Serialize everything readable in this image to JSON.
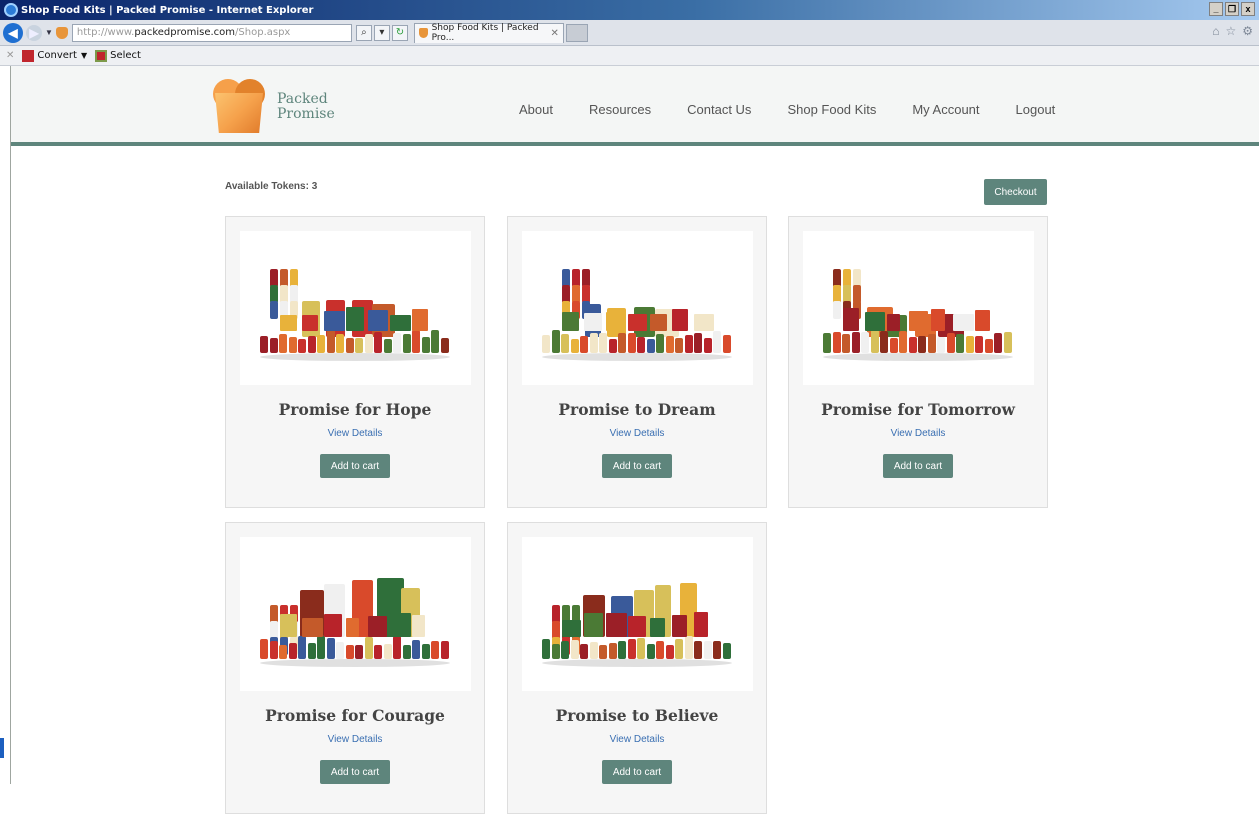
{
  "browser": {
    "window_title": "Shop Food Kits | Packed Promise - Internet Explorer",
    "url_prefix": "http://www.",
    "url_domain": "packedpromise.com",
    "url_path": "/Shop.aspx",
    "tab_title": "Shop Food Kits | Packed Pro...",
    "toolbar": {
      "convert_label": "Convert",
      "select_label": "Select"
    }
  },
  "site": {
    "logo_line1": "Packed",
    "logo_line2": "Promise",
    "nav": [
      "About",
      "Resources",
      "Contact Us",
      "Shop Food Kits",
      "My Account",
      "Logout"
    ]
  },
  "shop": {
    "tokens_label": "Available Tokens: 3",
    "checkout_label": "Checkout",
    "view_details_label": "View Details",
    "add_to_cart_label": "Add to cart",
    "products": [
      {
        "name": "Promise for Hope"
      },
      {
        "name": "Promise to Dream"
      },
      {
        "name": "Promise for Tomorrow"
      },
      {
        "name": "Promise for Courage"
      },
      {
        "name": "Promise to Believe"
      }
    ]
  },
  "colors": {
    "accent": "#5e857c",
    "link": "#3a6fb2",
    "logo_orange": "#f6a04a"
  }
}
